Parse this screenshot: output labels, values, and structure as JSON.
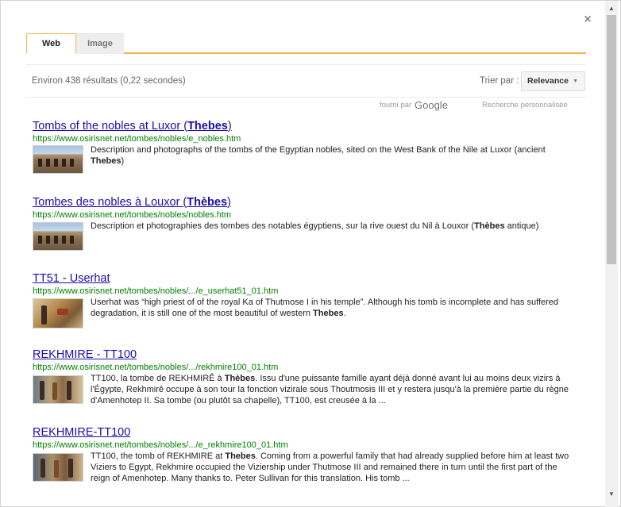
{
  "dialog": {
    "close_label": "×"
  },
  "tabs": [
    {
      "label": "Web",
      "active": true
    },
    {
      "label": "Image",
      "active": false
    }
  ],
  "toolbar": {
    "result_count": "Environ 438 résultats (0,22 secondes)",
    "sort_label": "Trier par :",
    "sort_value": "Relevance"
  },
  "branding": {
    "powered_by": "fourni par",
    "google": "Google",
    "custom_search": "Recherche personnalisée"
  },
  "results": [
    {
      "title_pre": "Tombs of the nobles at Luxor (",
      "title_bold": "Thebes",
      "title_post": ")",
      "url": "https://www.osirisnet.net/tombes/nobles/e_nobles.htm",
      "snippet_pre": "Description and photographs of the tombs of the Egyptian nobles, sited on the West Bank of the Nile at Luxor (ancient ",
      "snippet_bold": "Thebes",
      "snippet_post": ")",
      "ellipsis": ""
    },
    {
      "title_pre": "Tombes des nobles à Louxor (",
      "title_bold": "Thèbes",
      "title_post": ")",
      "url": "https://www.osirisnet.net/tombes/nobles/nobles.htm",
      "snippet_pre": "Description et photographies des tombes des notables égyptiens, sur la rive ouest du Nil à Louxor (",
      "snippet_bold": "Thèbes",
      "snippet_post": " antique)",
      "ellipsis": ""
    },
    {
      "title_pre": "TT51 - Userhat",
      "title_bold": "",
      "title_post": "",
      "url": "https://www.osirisnet.net/tombes/nobles/.../e_userhat51_01.htm",
      "snippet_pre": "Userhat was “high priest of of the royal Ka of Thutmose I in his temple”. Although his tomb is incomplete and has suffered degradation, it is still one of the most beautiful of western ",
      "snippet_bold": "Thebes",
      "snippet_post": ".",
      "ellipsis": ""
    },
    {
      "title_pre": "REKHMIRE - TT100",
      "title_bold": "",
      "title_post": "",
      "url": "https://www.osirisnet.net/tombes/nobles/.../rekhmire100_01.htm",
      "snippet_pre": "TT100, la tombe de REKHMIRÊ à ",
      "snippet_bold": "Thèbes",
      "snippet_post": ". Issu d'une puissante famille ayant déjà donné avant lui au moins deux vizirs à l'Égypte, Rekhmirê occupe à son tour la fonction vizirale sous Thoutmosis III et y restera jusqu'à la première partie du règne d'Amenhotep II. Sa tombe (ou plutôt sa chapelle), TT100, est creusée à la ",
      "ellipsis": "..."
    },
    {
      "title_pre": "REKHMIRE-TT100",
      "title_bold": "",
      "title_post": "",
      "url": "https://www.osirisnet.net/tombes/nobles/.../e_rekhmire100_01.htm",
      "snippet_pre": "TT100, the tomb of REKHMIRE at ",
      "snippet_bold": "Thebes",
      "snippet_post": ". Coming from a powerful family that had already supplied before him at least two Viziers to Egypt, Rekhmire occupied the Viziership under Thutmose III and remained there in turn until the first part of the reign of Amenhotep. Many thanks to. Peter Sullivan for this translation. His tomb ",
      "ellipsis": "..."
    }
  ]
}
